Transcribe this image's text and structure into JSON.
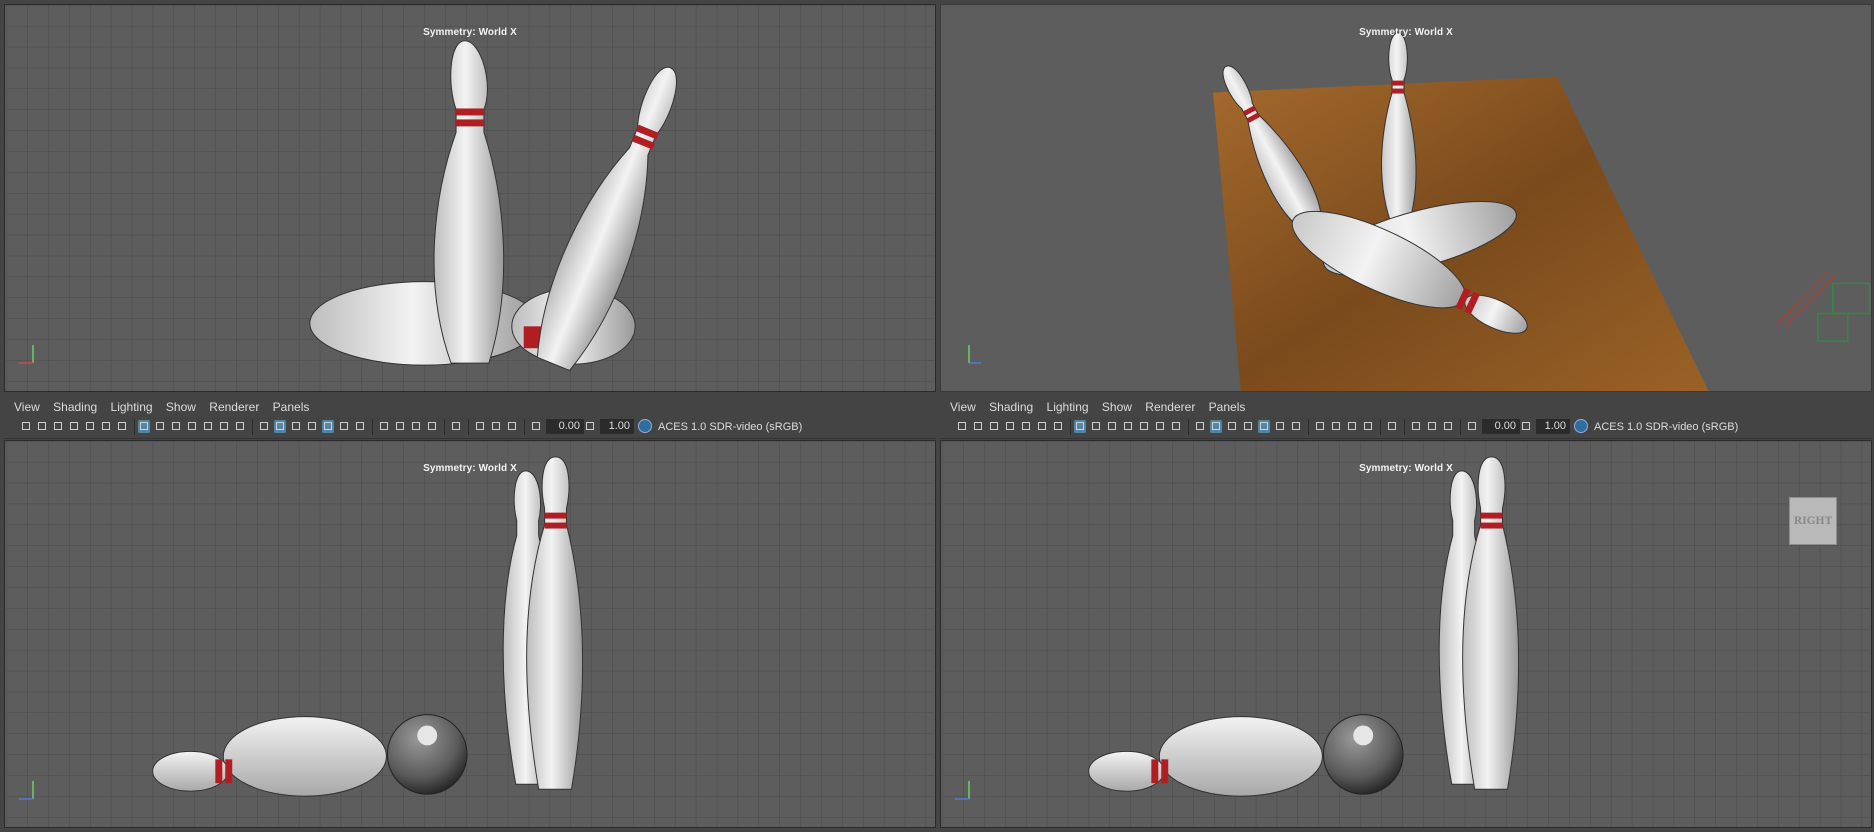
{
  "menus": [
    "View",
    "Shading",
    "Lighting",
    "Show",
    "Renderer",
    "Panels"
  ],
  "viewports": [
    {
      "id": "top-left",
      "symmetry": "Symmetry: World X"
    },
    {
      "id": "top-right",
      "symmetry": "Symmetry: World X"
    },
    {
      "id": "bottom-left",
      "symmetry": "Symmetry: World X"
    },
    {
      "id": "bottom-right",
      "symmetry": "Symmetry: World X"
    }
  ],
  "panel_left": {
    "menus": [
      "View",
      "Shading",
      "Lighting",
      "Show",
      "Renderer",
      "Panels"
    ],
    "exposure": "0.00",
    "gamma": "1.00",
    "color_space": "ACES 1.0 SDR-video (sRGB)"
  },
  "panel_right": {
    "menus": [
      "View",
      "Shading",
      "Lighting",
      "Show",
      "Renderer",
      "Panels"
    ],
    "exposure": "0.00",
    "gamma": "1.00",
    "color_space": "ACES 1.0 SDR-video (sRGB)",
    "viewcube": "RIGHT"
  },
  "colors": {
    "viewport_bg": "#5d5d5d",
    "grid": "#4a4a4a",
    "pin": "#ececec",
    "stripe": "#b01e24",
    "lane": "#8a5a28",
    "ui_bg": "#444444",
    "active_icon": "#5285a6"
  }
}
